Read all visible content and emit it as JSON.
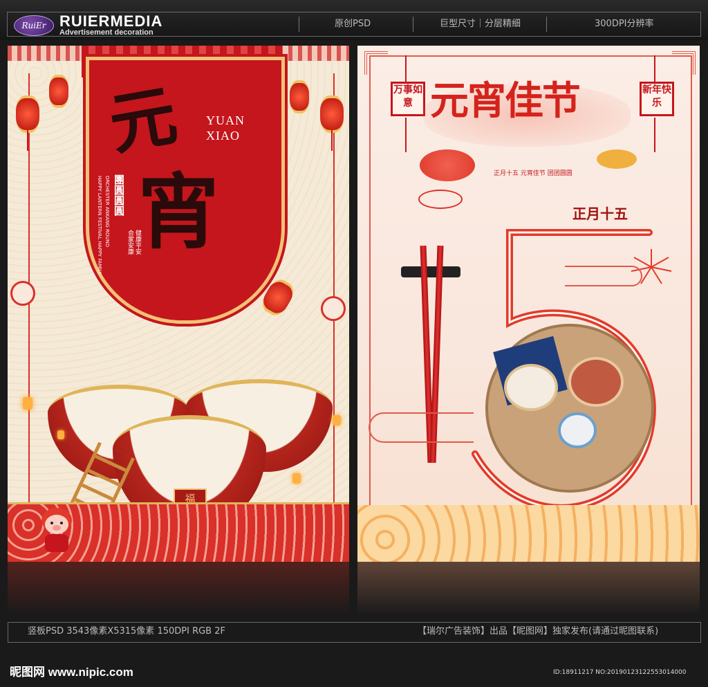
{
  "header": {
    "logo_text": "RuiEr",
    "brand": "RUIERMEDIA",
    "brand_sub": "Advertisement decoration",
    "items": [
      "原创PSD",
      "巨型尺寸｜分层精细",
      "300DPI分辨率"
    ]
  },
  "left_poster": {
    "big_char_1": "元",
    "big_char_2": "宵",
    "en_line_1": "YUAN",
    "en_line_2": "XIAO",
    "vertical_en_1": "HAPPY LANTERN FESTIVAL HAPPY FAMILY",
    "vertical_en_2": "ORCHESTER ANKANG ROUND",
    "vertical_cn_1": "團圓圓圓",
    "vertical_cn_2": "合家安康",
    "vertical_cn_3": "健康平安",
    "bowl_mark": "福"
  },
  "right_poster": {
    "title": "元宵佳节",
    "date": "正月十五",
    "subtitle": "正月十五 元宵佳节 团团圆圆",
    "seal_left": "万事如意",
    "seal_right": "新年快乐"
  },
  "footer": {
    "spec": "竖板PSD 3543像素X5315像素 150DPI RGB 2F",
    "credit": "【瑞尔广告装饰】出品【昵图网】独家发布(请通过昵图联系)",
    "watermark": "昵图网 www.nipic.com",
    "id": "ID:18911217 NO:20190123122553014000"
  },
  "colors": {
    "background": "#1a1a1a",
    "festive_red": "#c4161c",
    "gold": "#e0b45a",
    "cream": "#f5ead7"
  }
}
